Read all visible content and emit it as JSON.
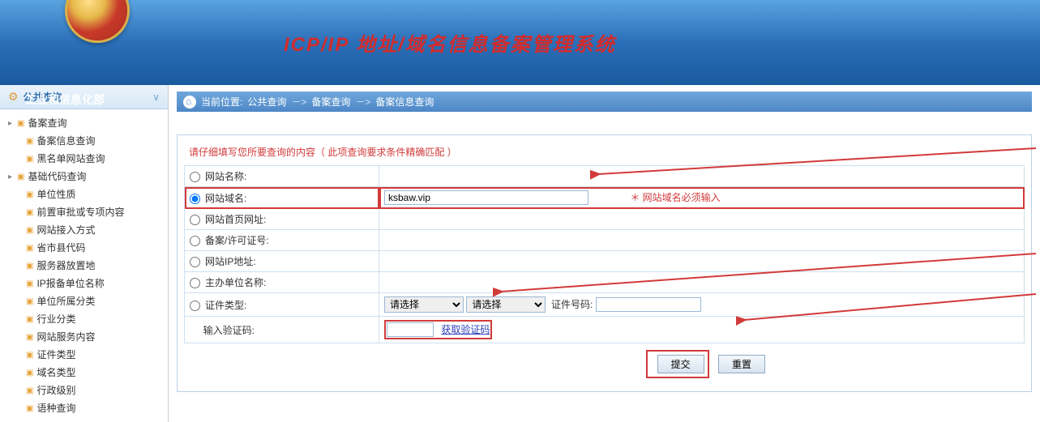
{
  "header": {
    "org": "工业和信息化部",
    "title": "ICP/IP 地址/域名信息备案管理系统"
  },
  "sidebar": {
    "header": "公共查询",
    "group1": {
      "title": "备案查询",
      "items": [
        "备案信息查询",
        "黑名单网站查询"
      ]
    },
    "group2": {
      "title": "基础代码查询",
      "items": [
        "单位性质",
        "前置审批或专项内容",
        "网站接入方式",
        "省市县代码",
        "服务器放置地",
        "IP报备单位名称",
        "单位所属分类",
        "行业分类",
        "网站服务内容",
        "证件类型",
        "域名类型",
        "行政级别",
        "语种查询"
      ]
    }
  },
  "breadcrumb": {
    "loc_label": "当前位置:",
    "lvl1": "公共查询",
    "lvl2": "备案查询",
    "lvl3": "备案信息查询",
    "sep": "－>"
  },
  "form": {
    "hint": "请仔细填写您所要查询的内容（ 此项查询要求条件精确匹配 ）",
    "rows": {
      "site_name": "网站名称:",
      "domain": "网站域名:",
      "homepage": "网站首页网址:",
      "license": "备案/许可证号:",
      "ip": "网站IP地址:",
      "sponsor": "主办单位名称:",
      "cert_type": "证件类型:",
      "captcha": "输入验证码:"
    },
    "domain_value": "ksbaw.vip",
    "domain_required": "＊ 网站域名必须输入",
    "cert_select_placeholder": "请选择",
    "cert_no_label": "证件号码:",
    "captcha_link": "获取验证码",
    "buttons": {
      "submit": "提交",
      "reset": "重置"
    }
  }
}
